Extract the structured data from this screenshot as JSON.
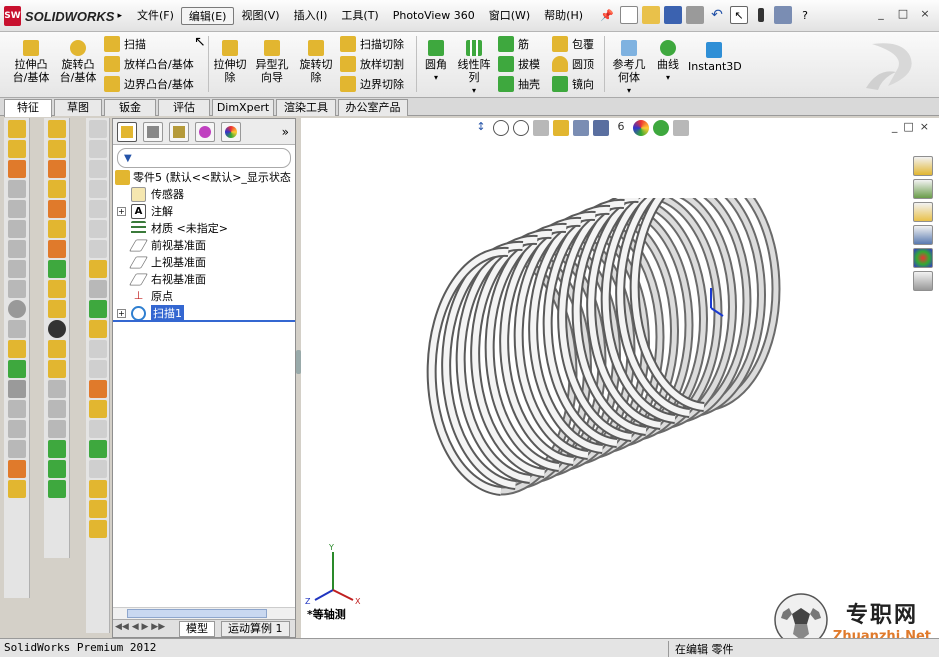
{
  "app": {
    "logo_text": "SOLIDWORKS",
    "logo_badge": "SW"
  },
  "menu": {
    "items": [
      "文件(F)",
      "编辑(E)",
      "视图(V)",
      "插入(I)",
      "工具(T)",
      "PhotoView 360",
      "窗口(W)",
      "帮助(H)"
    ]
  },
  "window_controls": [
    "_",
    "□",
    "×"
  ],
  "command_manager": {
    "extrude_boss": "拉伸凸\n台/基体",
    "revolve_boss": "旋转凸\n台/基体",
    "sweep": "扫描",
    "loft_boss": "放样凸台/基体",
    "boundary_boss": "边界凸台/基体",
    "extrude_cut": "拉伸切\n除",
    "hole_wizard": "异型孔\n向导",
    "revolve_cut": "旋转切\n除",
    "sweep_cut": "扫描切除",
    "loft_cut": "放样切割",
    "boundary_cut": "边界切除",
    "fillet": "圆角",
    "linear_pattern": "线性阵\n列",
    "rib": "筋",
    "draft": "拔模",
    "shell": "抽壳",
    "wrap": "包覆",
    "dome": "圆顶",
    "mirror": "镜向",
    "reference_geometry": "参考几\n何体",
    "curves": "曲线",
    "instant3d": "Instant3D"
  },
  "tabs": [
    "特征",
    "草图",
    "钣金",
    "评估",
    "DimXpert",
    "渲染工具",
    "办公室产品"
  ],
  "feature_tree": {
    "root": "零件5  (默认<<默认>_显示状态",
    "nodes": [
      {
        "label": "传感器",
        "icon": "sensor-icon",
        "expandable": false
      },
      {
        "label": "注解",
        "icon": "annotation-icon",
        "expandable": true
      },
      {
        "label": "材质 <未指定>",
        "icon": "material-icon",
        "expandable": false
      },
      {
        "label": "前视基准面",
        "icon": "plane-icon",
        "expandable": false
      },
      {
        "label": "上视基准面",
        "icon": "plane-icon",
        "expandable": false
      },
      {
        "label": "右视基准面",
        "icon": "plane-icon",
        "expandable": false
      },
      {
        "label": "原点",
        "icon": "origin-icon",
        "expandable": false
      },
      {
        "label": "扫描1",
        "icon": "sweep-icon",
        "expandable": true,
        "selected": true
      }
    ],
    "bottom_tabs": [
      "模型",
      "运动算例 1"
    ]
  },
  "graphics": {
    "view_label": "*等轴测"
  },
  "status": {
    "left": "SolidWorks Premium 2012",
    "mode": "在编辑 零件"
  },
  "watermark": {
    "title": "专职网",
    "url": "Zhuanzhi.Net"
  },
  "colors": {
    "selection": "#3467d1",
    "logo_red": "#c8102e"
  }
}
